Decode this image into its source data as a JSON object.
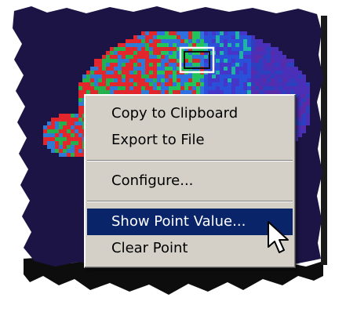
{
  "colors": {
    "plot_background": "#1d1446",
    "menu_face": "#d4d0c8",
    "menu_highlight": "#0a246a",
    "menu_highlight_text": "#ffffff"
  },
  "context_menu": {
    "items": [
      {
        "label": "Copy to Clipboard",
        "highlighted": false
      },
      {
        "label": "Export to File",
        "highlighted": false
      },
      {
        "label": "Configure...",
        "highlighted": false
      },
      {
        "label": "Show Point Value...",
        "highlighted": true
      },
      {
        "label": "Clear Point",
        "highlighted": false
      }
    ]
  },
  "icons": {
    "cursor": "arrow-cursor-icon",
    "selection": "point-selection-box"
  }
}
